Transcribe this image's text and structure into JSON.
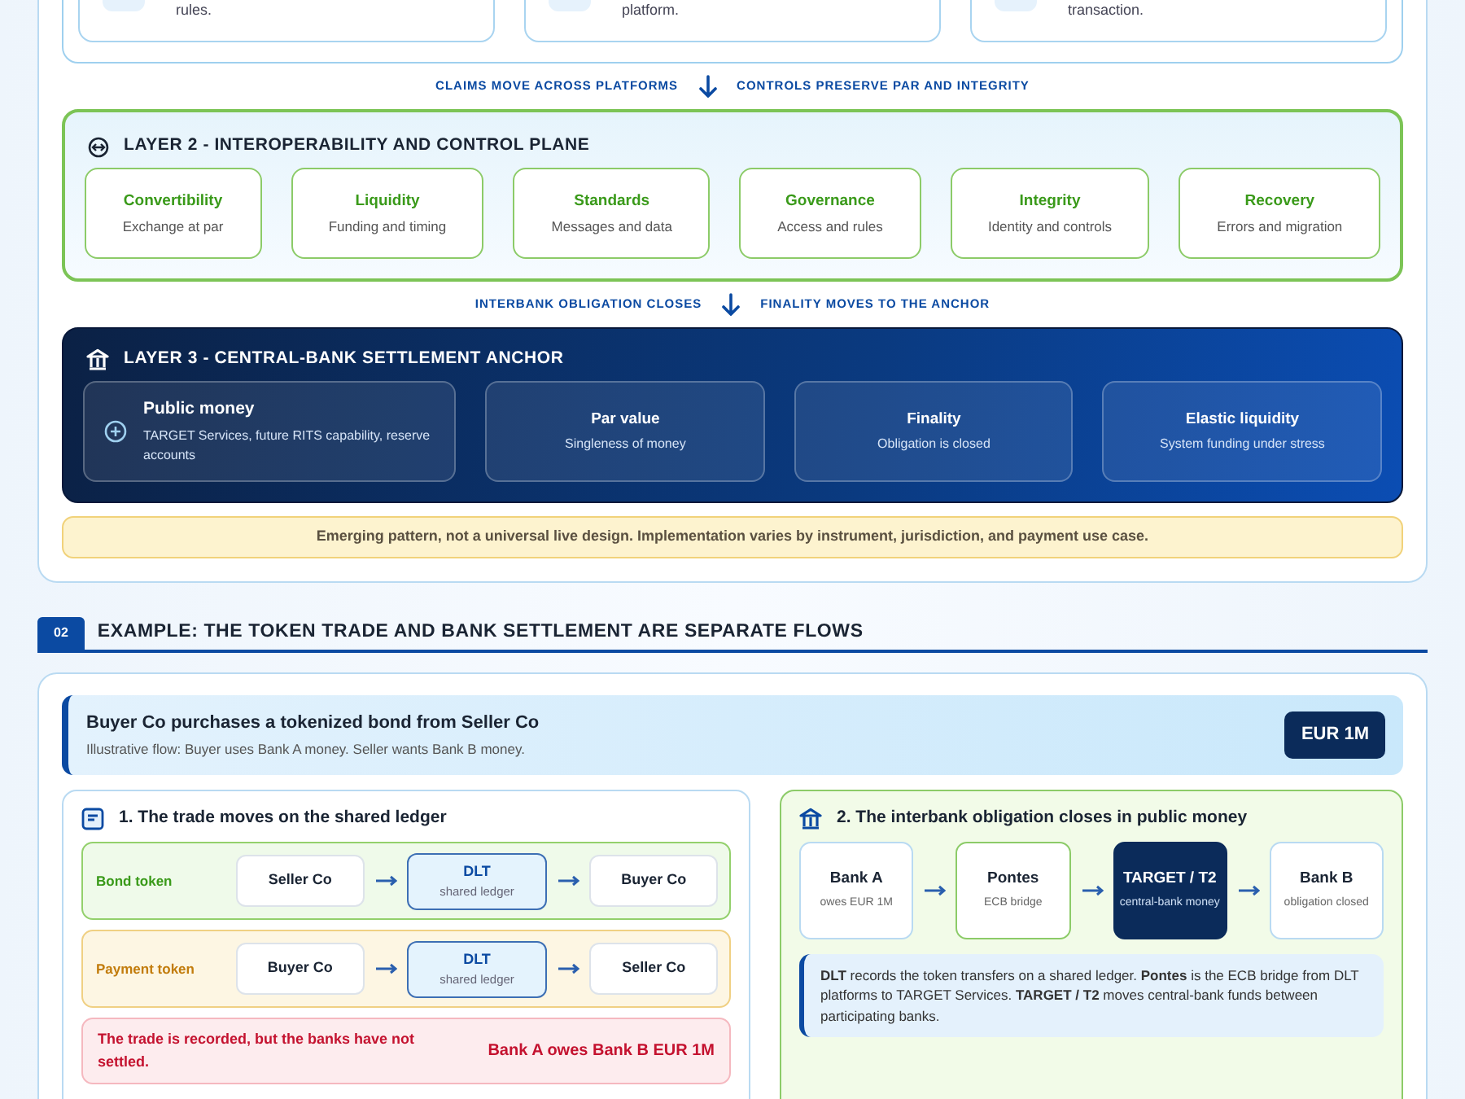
{
  "layer_1": {
    "cards": [
      {
        "text": "rules."
      },
      {
        "text": "platform."
      },
      {
        "text": "transaction."
      }
    ]
  },
  "connector_1": {
    "left": "CLAIMS MOVE ACROSS PLATFORMS",
    "right": "CONTROLS PRESERVE PAR AND INTEGRITY"
  },
  "layer_2": {
    "title": "LAYER 2 - INTEROPERABILITY AND CONTROL PLANE",
    "cards": [
      {
        "title": "Convertibility",
        "subtitle": "Exchange at par"
      },
      {
        "title": "Liquidity",
        "subtitle": "Funding and timing"
      },
      {
        "title": "Standards",
        "subtitle": "Messages and data"
      },
      {
        "title": "Governance",
        "subtitle": "Access and rules"
      },
      {
        "title": "Integrity",
        "subtitle": "Identity and controls"
      },
      {
        "title": "Recovery",
        "subtitle": "Errors and migration"
      }
    ]
  },
  "connector_2": {
    "left": "INTERBANK OBLIGATION CLOSES",
    "right": "FINALITY MOVES TO THE ANCHOR"
  },
  "layer_3": {
    "title": "LAYER 3 - CENTRAL-BANK SETTLEMENT ANCHOR",
    "cards": [
      {
        "kind": "featured",
        "title": "Public money",
        "subtitle": "TARGET Services, future RITS capability, reserve accounts"
      },
      {
        "kind": "plain",
        "title": "Par value",
        "subtitle": "Singleness of money"
      },
      {
        "kind": "plain",
        "title": "Finality",
        "subtitle": "Obligation is closed"
      },
      {
        "kind": "plain",
        "title": "Elastic liquidity",
        "subtitle": "System funding under stress"
      }
    ]
  },
  "note": "Emerging pattern, not a universal live design. Implementation varies by instrument, jurisdiction, and payment use case.",
  "section_2": {
    "number": "02",
    "title": "EXAMPLE: THE TOKEN TRADE AND BANK SETTLEMENT ARE SEPARATE FLOWS"
  },
  "example": {
    "title": "Buyer Co purchases a tokenized bond from Seller Co",
    "subtitle": "Illustrative flow: Buyer uses Bank A money. Seller wants Bank B money.",
    "amount": "EUR 1M",
    "trade_panel": {
      "title": "1. The trade moves on the shared ledger",
      "flows": [
        {
          "kind": "bond",
          "label": "Bond token",
          "from": "Seller Co",
          "via": {
            "title": "DLT",
            "subtitle": "shared ledger"
          },
          "to": "Buyer Co"
        },
        {
          "kind": "payment",
          "label": "Payment token",
          "from": "Buyer Co",
          "via": {
            "title": "DLT",
            "subtitle": "shared ledger"
          },
          "to": "Seller Co"
        }
      ],
      "alert": {
        "message": "The trade is recorded, but the banks have not settled.",
        "amount": "Bank A owes Bank B EUR 1M"
      }
    },
    "settlement_panel": {
      "title": "2. The interbank obligation closes in public money",
      "nodes": [
        {
          "kind": "bank",
          "title": "Bank A",
          "subtitle": "owes EUR 1M"
        },
        {
          "kind": "bridge",
          "title": "Pontes",
          "subtitle": "ECB bridge"
        },
        {
          "kind": "anchor",
          "title": "TARGET / T2",
          "subtitle": "central-bank money"
        },
        {
          "kind": "bank",
          "title": "Bank B",
          "subtitle": "obligation closed"
        }
      ],
      "explanation": "**DLT** records the token transfers on a shared ledger. **Pontes** is the ECB bridge from DLT platforms to TARGET Services. **TARGET / T2** moves central-bank funds between participating banks."
    }
  }
}
